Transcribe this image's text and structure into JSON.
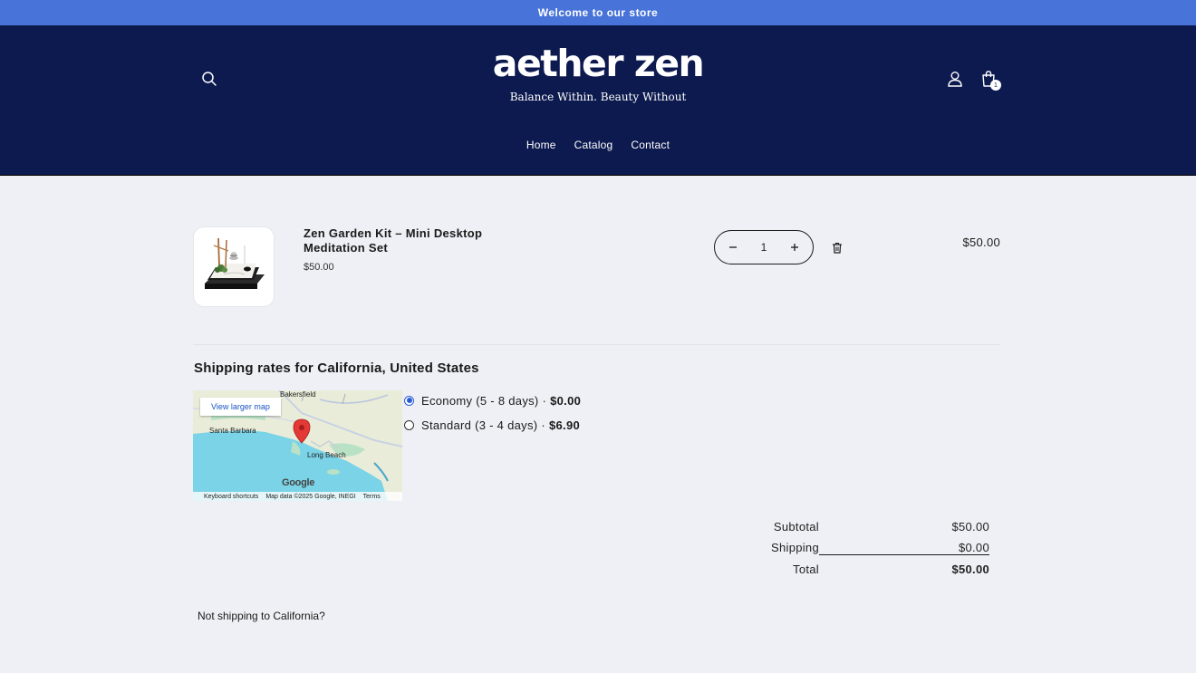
{
  "announcement": "Welcome to our store",
  "brand": {
    "name": "aether zen",
    "tagline": "Balance Within. Beauty Without"
  },
  "header": {
    "cart_count": "1"
  },
  "nav": [
    {
      "label": "Home"
    },
    {
      "label": "Catalog"
    },
    {
      "label": "Contact"
    }
  ],
  "cart_item": {
    "title": "Zen Garden Kit – Mini Desktop Meditation Set",
    "unit_price": "$50.00",
    "quantity": "1",
    "line_total": "$50.00"
  },
  "shipping": {
    "heading": "Shipping rates for California, United States",
    "map": {
      "button": "View larger map",
      "labels": [
        "Bakersfield",
        "Santa Barbara",
        "Long Beach"
      ],
      "google": "Google",
      "footer": [
        "Keyboard shortcuts",
        "Map data ©2025 Google, INEGI",
        "Terms"
      ]
    },
    "rates": [
      {
        "label": "Economy (5 - 8 days) ·",
        "price": "$0.00",
        "selected": true
      },
      {
        "label": "Standard (3 - 4 days) ·",
        "price": "$6.90",
        "selected": false
      }
    ]
  },
  "totals": {
    "subtotal_label": "Subtotal",
    "subtotal": "$50.00",
    "shipping_label": "Shipping",
    "shipping": "$0.00",
    "total_label": "Total",
    "total": "$50.00"
  },
  "not_shipping_link": "Not shipping to California?",
  "colors": {
    "announcement_bg": "#4873d8",
    "header_bg": "#0d1a4f",
    "page_bg": "#eff0f5",
    "radio_accent": "#2a5bd7"
  }
}
